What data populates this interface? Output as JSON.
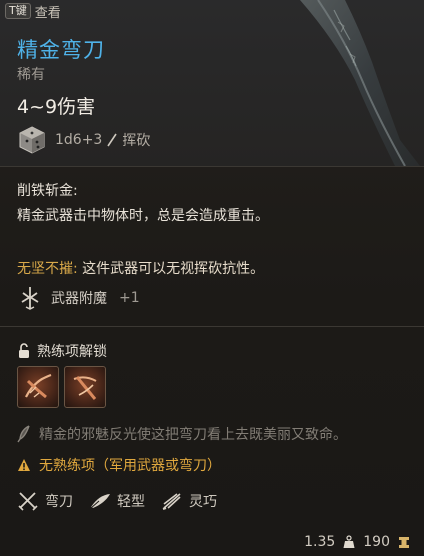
{
  "hint": {
    "key": "T键",
    "label": "查看"
  },
  "item": {
    "name": "精金弯刀",
    "rarity": "稀有",
    "damage": "4~9伤害",
    "dice": "1d6+3",
    "damage_type": "挥砍"
  },
  "description": {
    "title": "削铁斩金:",
    "body": "精金武器击中物体时，总是会造成重击。"
  },
  "ability": {
    "name": "无坚不摧:",
    "text": " 这件武器可以无视挥砍抗性。"
  },
  "enchant": {
    "label": "武器附魔",
    "value": "+1"
  },
  "proficiency": {
    "label": "熟练项解锁",
    "slots": [
      {
        "icon": "sword-arm-icon"
      },
      {
        "icon": "crossbow-arm-icon"
      }
    ]
  },
  "flavor": "精金的邪魅反光使这把弯刀看上去既美丽又致命。",
  "warning": "无熟练项（军用武器或弯刀）",
  "tags": [
    {
      "icon": "scimitar-icon",
      "label": "弯刀"
    },
    {
      "icon": "feather-icon",
      "label": "轻型"
    },
    {
      "icon": "finesse-icon",
      "label": "灵巧"
    }
  ],
  "footer": {
    "weight": "1.35",
    "price": "190"
  },
  "colors": {
    "title": "#4fb2e8",
    "ability": "#d9a94a",
    "warning": "#e0a83e",
    "flavor": "#827d75"
  }
}
